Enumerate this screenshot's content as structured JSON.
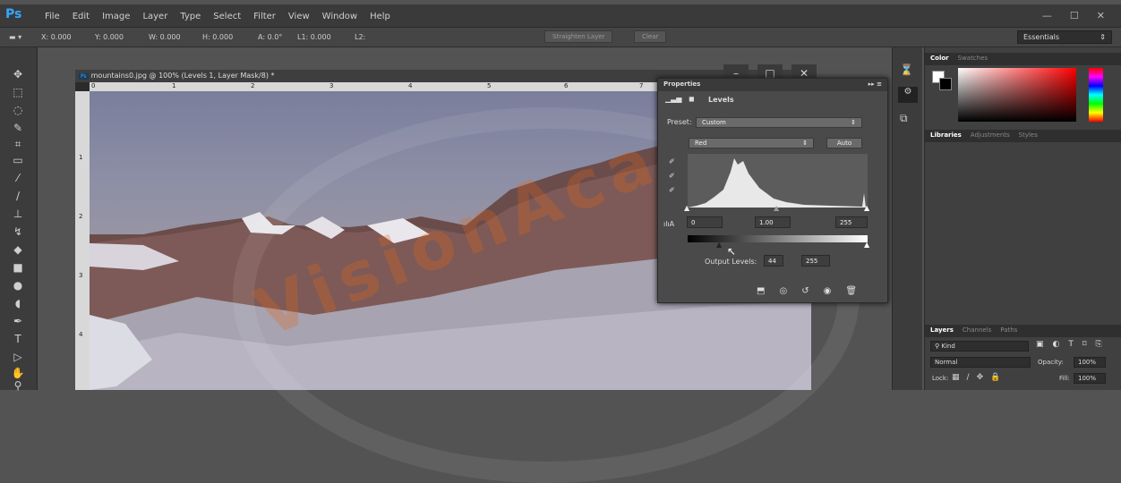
{
  "app": {
    "logo": "Ps"
  },
  "menubar": {
    "items": [
      "File",
      "Edit",
      "Image",
      "Layer",
      "Type",
      "Select",
      "Filter",
      "View",
      "Window",
      "Help"
    ],
    "window_controls": [
      "—",
      "☐",
      "✕"
    ]
  },
  "options": {
    "x": "X: 0.000",
    "y": "Y: 0.000",
    "w": "W: 0.000",
    "h": "H: 0.000",
    "a": "A: 0.0°",
    "l1": "L1: 0.000",
    "l2": "L2:",
    "straighten": "Straighten Layer",
    "clear": "Clear",
    "workspace": "Essentials"
  },
  "document": {
    "title": "mountains0.jpg @ 100% (Levels 1, Layer Mask/8) *",
    "ruler_top": [
      "0",
      "1",
      "2",
      "3",
      "4",
      "5",
      "6",
      "7"
    ],
    "ruler_left": [
      "1",
      "2",
      "3",
      "4"
    ]
  },
  "properties": {
    "title": "Properties",
    "section": "Levels",
    "preset_label": "Preset:",
    "preset_value": "Custom",
    "channel": "Red",
    "auto": "Auto",
    "input_black": "0",
    "input_gamma": "1.00",
    "input_white": "255",
    "output_label": "Output Levels:",
    "output_black": "44",
    "output_white": "255"
  },
  "right": {
    "color_tabs": [
      "Color",
      "Swatches"
    ],
    "lib_tabs": [
      "Libraries",
      "Adjustments",
      "Styles"
    ],
    "layer_tabs": [
      "Layers",
      "Channels",
      "Paths"
    ],
    "kind": "Kind",
    "blend": "Normal",
    "opacity_label": "Opacity:",
    "opacity": "100%",
    "lock_label": "Lock:",
    "fill_label": "Fill:",
    "fill": "100%"
  },
  "watermark": {
    "text": "VisionAcad"
  }
}
